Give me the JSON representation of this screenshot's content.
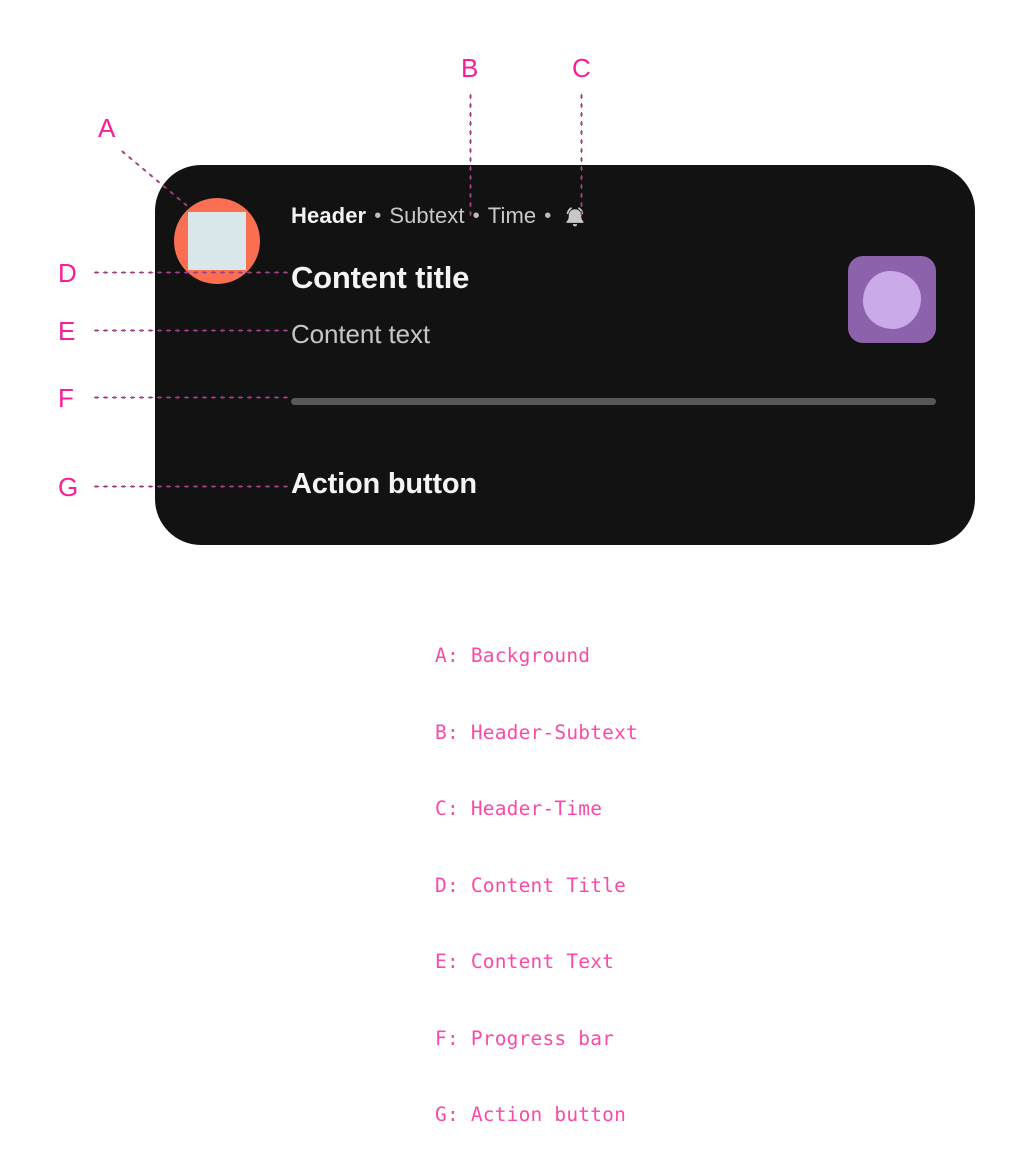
{
  "card": {
    "background_color": "#121212",
    "header": {
      "title": "Header",
      "subtext": "Subtext",
      "time": "Time",
      "separator": "•",
      "bell_icon": "bell-icon"
    },
    "avatar": {
      "icon": "avatar-squircle-icon",
      "circle_color": "#fa6f52",
      "glyph_color": "#d9e7ea"
    },
    "content_title": "Content title",
    "content_text": "Content text",
    "thumbnail": {
      "icon": "thumbnail-image",
      "tile_color": "#8b62ab",
      "blob_color": "#cbaae9"
    },
    "progress_bar": {
      "track_color": "#585858",
      "value_percent": 100
    },
    "action_button": "Action button"
  },
  "callouts": [
    {
      "letter": "A",
      "target": "Background"
    },
    {
      "letter": "B",
      "target": "Header-Subtext"
    },
    {
      "letter": "C",
      "target": "Header-Time"
    },
    {
      "letter": "D",
      "target": "Content Title"
    },
    {
      "letter": "E",
      "target": "Content Text"
    },
    {
      "letter": "F",
      "target": "Progress bar"
    },
    {
      "letter": "G",
      "target": "Action button"
    }
  ],
  "legend": {
    "accent_color": "#fa4aa8",
    "lines": [
      "A: Background",
      "B: Header-Subtext",
      "C: Header-Time",
      "D: Content Title",
      "E: Content Text",
      "F: Progress bar",
      "G: Action button"
    ]
  }
}
